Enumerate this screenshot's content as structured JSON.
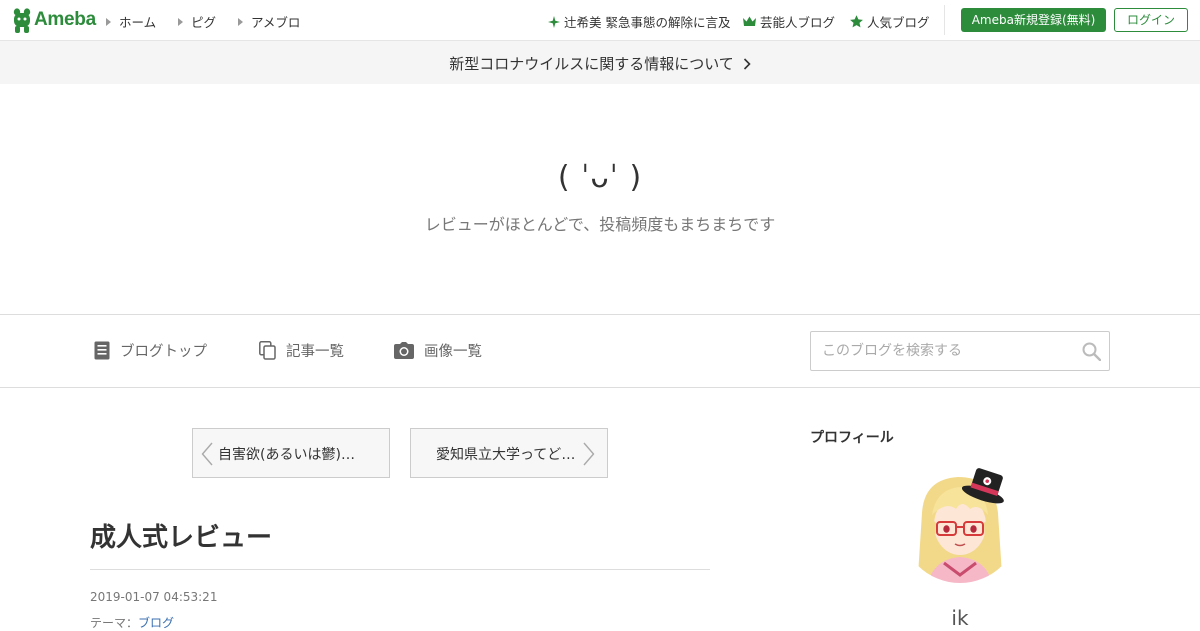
{
  "header": {
    "logo_text": "Ameba",
    "nav_left": [
      {
        "label": "ホーム"
      },
      {
        "label": "ピグ"
      },
      {
        "label": "アメブロ"
      }
    ],
    "nav_right": [
      {
        "label": "辻希美 緊急事態の解除に言及",
        "icon": "sparkle-icon"
      },
      {
        "label": "芸能人ブログ",
        "icon": "crown-icon"
      },
      {
        "label": "人気ブログ",
        "icon": "star-icon"
      }
    ],
    "register_label": "Ameba新規登録(無料)",
    "login_label": "ログイン",
    "brand_color": "#2d8c3c"
  },
  "announcement": {
    "text": "新型コロナウイルスに関する情報について"
  },
  "blog": {
    "title": "( ˈᴗˈ )",
    "description": "レビューがほとんどで、投稿頻度もまちまちです"
  },
  "blog_nav": {
    "items": [
      {
        "label": "ブログトップ",
        "icon": "document-icon"
      },
      {
        "label": "記事一覧",
        "icon": "copy-icon"
      },
      {
        "label": "画像一覧",
        "icon": "camera-icon"
      }
    ],
    "search_placeholder": "このブログを検索する"
  },
  "pager": {
    "prev": "自害欲(あるいは鬱)について",
    "next": "愛知県立大学ってどんなところ"
  },
  "article": {
    "title": "成人式レビュー",
    "date": "2019-01-07 04:53:21",
    "theme_label": "テーマ：",
    "theme_value": "ブログ"
  },
  "profile": {
    "heading": "プロフィール",
    "name": "ik"
  }
}
